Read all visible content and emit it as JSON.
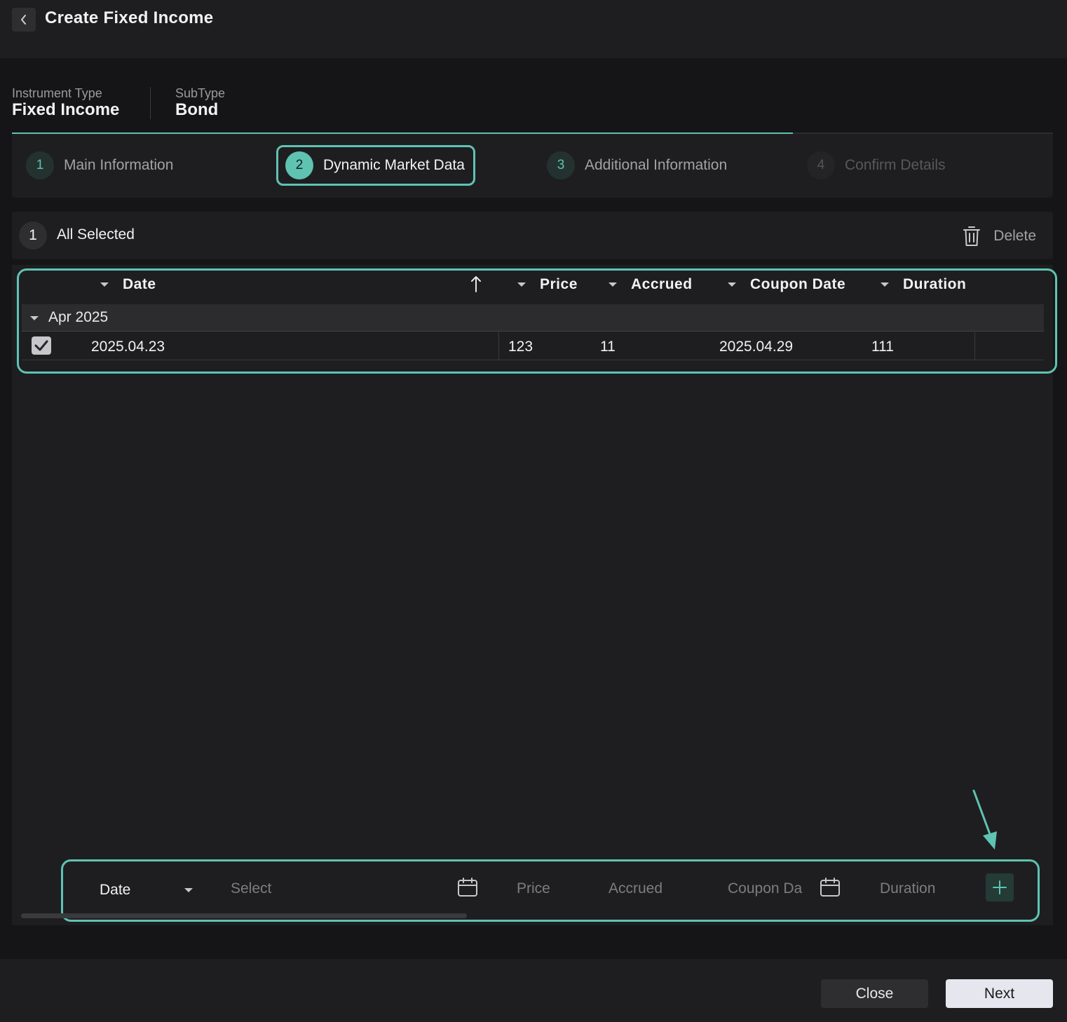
{
  "header": {
    "title": "Create Fixed Income"
  },
  "meta": {
    "instrument_type_label": "Instrument Type",
    "instrument_type_value": "Fixed Income",
    "subtype_label": "SubType",
    "subtype_value": "Bond"
  },
  "steps": [
    {
      "num": "1",
      "label": "Main Information",
      "state": "done"
    },
    {
      "num": "2",
      "label": "Dynamic Market Data",
      "state": "active"
    },
    {
      "num": "3",
      "label": "Additional Information",
      "state": "pending"
    },
    {
      "num": "4",
      "label": "Confirm Details",
      "state": "disabled"
    }
  ],
  "selection": {
    "count": "1",
    "label": "All Selected",
    "delete_label": "Delete"
  },
  "grid": {
    "columns": [
      "Date",
      "Price",
      "Accrued",
      "Coupon Date",
      "Duration"
    ],
    "group_label": "Apr 2025",
    "rows": [
      {
        "date": "2025.04.23",
        "price": "123",
        "accrued": "11",
        "coupon_date": "2025.04.29",
        "duration": "111",
        "checked": true
      }
    ]
  },
  "add_row": {
    "date_type": "Date",
    "date_placeholder": "Select",
    "price_placeholder": "Price",
    "accrued_placeholder": "Accrued",
    "coupon_placeholder": "Coupon Da",
    "duration_placeholder": "Duration"
  },
  "footer": {
    "close_label": "Close",
    "next_label": "Next"
  },
  "colors": {
    "accent": "#5fc3b2",
    "background": "#151517",
    "panel": "#1e1e20"
  }
}
